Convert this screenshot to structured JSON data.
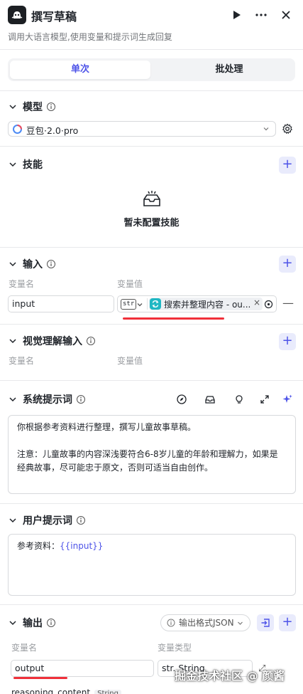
{
  "header": {
    "title": "撰写草稿",
    "subtitle": "调用大语言模型,使用变量和提示词生成回复"
  },
  "tabs": {
    "single": "单次",
    "batch": "批处理"
  },
  "model": {
    "title": "模型",
    "selected": "豆包·2.0·pro"
  },
  "skills": {
    "title": "技能",
    "empty_text": "暂未配置技能"
  },
  "input": {
    "title": "输入",
    "col_name": "变量名",
    "col_value": "变量值",
    "rows": [
      {
        "name": "input",
        "type_tag": "str",
        "ref_text": "搜索并整理内容 - ou..."
      }
    ]
  },
  "visual_input": {
    "title": "视觉理解输入",
    "col_name": "变量名",
    "col_value": "变量值"
  },
  "system_prompt": {
    "title": "系统提示词",
    "line1": "你根据参考资料进行整理，撰写儿童故事草稿。",
    "line2": "注意：儿童故事的内容深浅要符合6-8岁儿童的年龄和理解力，如果是",
    "line3": "经典故事，尽可能忠于原文，否则可适当自由创作。"
  },
  "user_prompt": {
    "title": "用户提示词",
    "prefix": "参考资料：",
    "variable": "{{input}}"
  },
  "output": {
    "title": "输出",
    "format_label": "输出格式JSON",
    "col_name": "变量名",
    "col_type": "变量类型",
    "row_name": "output",
    "row_type": "str. String",
    "next_name": "reasoning_content",
    "next_type": "String"
  },
  "watermark": "掘金技术社区 @ 颜酱",
  "colors": {
    "accent": "#4d53e8",
    "highlight_red": "#f0303a",
    "ref_icon": "#1fb7c3"
  }
}
